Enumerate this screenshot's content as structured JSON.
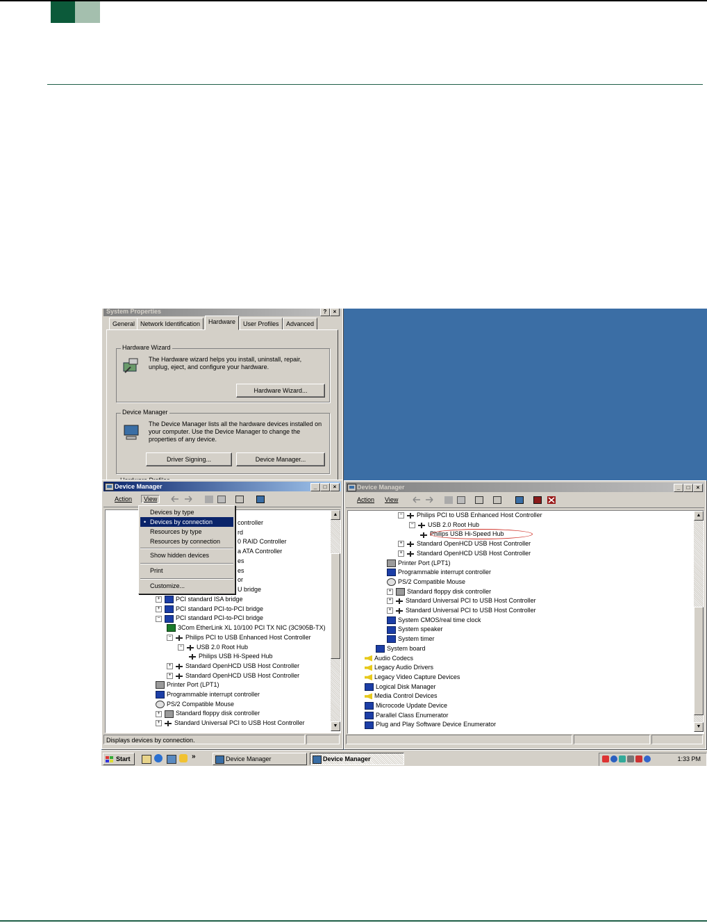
{
  "system_properties": {
    "title": "System Properties",
    "tabs": [
      "General",
      "Network Identification",
      "Hardware",
      "User Profiles",
      "Advanced"
    ],
    "hardware_wizard": {
      "group_label": "Hardware Wizard",
      "description": "The Hardware wizard helps you install, uninstall, repair, unplug, eject, and configure your hardware.",
      "button": "Hardware Wizard..."
    },
    "device_manager": {
      "group_label": "Device Manager",
      "description": "The Device Manager lists all the hardware devices installed on your computer. Use the Device Manager to change the properties of any device.",
      "driver_signing_button": "Driver Signing...",
      "device_manager_button": "Device Manager..."
    },
    "partial_group_label": "Hardware Profiles"
  },
  "dm_left": {
    "title": "Device Manager",
    "menu": {
      "action": "Action",
      "view": "View"
    },
    "status": "Displays devices by connection.",
    "view_menu": [
      {
        "label": "Devices by type",
        "selected": false,
        "bullet": false
      },
      {
        "label": "Devices by connection",
        "selected": true,
        "bullet": true
      },
      {
        "label": "Resources by type",
        "selected": false,
        "bullet": false
      },
      {
        "label": "Resources by connection",
        "selected": false,
        "bullet": false
      },
      {
        "label": "Show hidden devices",
        "selected": false,
        "bullet": false
      },
      {
        "label": "Print",
        "selected": false,
        "bullet": false
      },
      {
        "label": "Customize...",
        "selected": false,
        "bullet": false
      }
    ],
    "visible_partials": [
      "controller",
      "rd",
      "0 RAID Controller",
      "a ATA Controller",
      "es",
      "es",
      "or",
      "U bridge"
    ],
    "tree": [
      {
        "label": "PCI standard ISA bridge",
        "icon": "dev",
        "exp": "+",
        "indent": 1
      },
      {
        "label": "PCI standard PCI-to-PCI bridge",
        "icon": "dev",
        "exp": "+",
        "indent": 1
      },
      {
        "label": "PCI standard PCI-to-PCI bridge",
        "icon": "dev",
        "exp": "-",
        "indent": 1
      },
      {
        "label": "3Com EtherLink XL 10/100 PCI TX NIC (3C905B-TX)",
        "icon": "net",
        "exp": "",
        "indent": 2
      },
      {
        "label": "Philips PCI to USB Enhanced Host Controller",
        "icon": "usb",
        "exp": "-",
        "indent": 2
      },
      {
        "label": "USB 2.0 Root Hub",
        "icon": "usb",
        "exp": "-",
        "indent": 3
      },
      {
        "label": "Philips USB Hi-Speed Hub",
        "icon": "usb",
        "exp": "",
        "indent": 4
      },
      {
        "label": "Standard OpenHCD USB Host Controller",
        "icon": "usb",
        "exp": "+",
        "indent": 2
      },
      {
        "label": "Standard OpenHCD USB Host Controller",
        "icon": "usb",
        "exp": "+",
        "indent": 2
      },
      {
        "label": "Printer Port (LPT1)",
        "icon": "prt",
        "exp": "",
        "indent": 1
      },
      {
        "label": "Programmable interrupt controller",
        "icon": "dev",
        "exp": "",
        "indent": 1
      },
      {
        "label": "PS/2 Compatible Mouse",
        "icon": "mouse",
        "exp": "",
        "indent": 1
      },
      {
        "label": "Standard floppy disk controller",
        "icon": "prt",
        "exp": "+",
        "indent": 1
      },
      {
        "label": "Standard Universal PCI to USB Host Controller",
        "icon": "usb",
        "exp": "+",
        "indent": 1
      }
    ]
  },
  "dm_right": {
    "title": "Device Manager",
    "menu": {
      "action": "Action",
      "view": "View"
    },
    "highlighted_item": "Philips USB Hi-Speed Hub",
    "tree": [
      {
        "label": "Philips PCI to USB Enhanced Host Controller",
        "icon": "usb",
        "exp": "-",
        "indent": 4
      },
      {
        "label": "USB 2.0 Root Hub",
        "icon": "usb",
        "exp": "-",
        "indent": 5
      },
      {
        "label": "Philips USB Hi-Speed Hub",
        "icon": "usb",
        "exp": "",
        "indent": 6
      },
      {
        "label": "Standard OpenHCD USB Host Controller",
        "icon": "usb",
        "exp": "+",
        "indent": 4
      },
      {
        "label": "Standard OpenHCD USB Host Controller",
        "icon": "usb",
        "exp": "+",
        "indent": 4
      },
      {
        "label": "Printer Port (LPT1)",
        "icon": "prt",
        "exp": "",
        "indent": 3
      },
      {
        "label": "Programmable interrupt controller",
        "icon": "dev",
        "exp": "",
        "indent": 3
      },
      {
        "label": "PS/2 Compatible Mouse",
        "icon": "mouse",
        "exp": "",
        "indent": 3
      },
      {
        "label": "Standard floppy disk controller",
        "icon": "prt",
        "exp": "+",
        "indent": 3
      },
      {
        "label": "Standard Universal PCI to USB Host Controller",
        "icon": "usb",
        "exp": "+",
        "indent": 3
      },
      {
        "label": "Standard Universal PCI to USB Host Controller",
        "icon": "usb",
        "exp": "+",
        "indent": 3
      },
      {
        "label": "System CMOS/real time clock",
        "icon": "dev",
        "exp": "",
        "indent": 3
      },
      {
        "label": "System speaker",
        "icon": "dev",
        "exp": "",
        "indent": 3
      },
      {
        "label": "System timer",
        "icon": "dev",
        "exp": "",
        "indent": 3
      },
      {
        "label": "System board",
        "icon": "dev",
        "exp": "",
        "indent": 2
      },
      {
        "label": "Audio Codecs",
        "icon": "snd",
        "exp": "",
        "indent": 1
      },
      {
        "label": "Legacy Audio Drivers",
        "icon": "snd",
        "exp": "",
        "indent": 1
      },
      {
        "label": "Legacy Video Capture Devices",
        "icon": "snd",
        "exp": "",
        "indent": 1
      },
      {
        "label": "Logical Disk Manager",
        "icon": "dev",
        "exp": "",
        "indent": 1
      },
      {
        "label": "Media Control Devices",
        "icon": "snd",
        "exp": "",
        "indent": 1
      },
      {
        "label": "Microcode Update Device",
        "icon": "dev",
        "exp": "",
        "indent": 1
      },
      {
        "label": "Parallel Class Enumerator",
        "icon": "dev",
        "exp": "",
        "indent": 1
      },
      {
        "label": "Plug and Play Software Device Enumerator",
        "icon": "dev",
        "exp": "",
        "indent": 1
      }
    ]
  },
  "taskbar": {
    "start": "Start",
    "chevron": "»",
    "buttons": [
      "Device Manager",
      "Device Manager"
    ],
    "clock": "1:33 PM"
  },
  "colors": {
    "accent_dark": "#0c5a3a",
    "accent_light": "#a4bfae",
    "desktop": "#3b6ea5",
    "highlight_circle": "#d0332a"
  }
}
